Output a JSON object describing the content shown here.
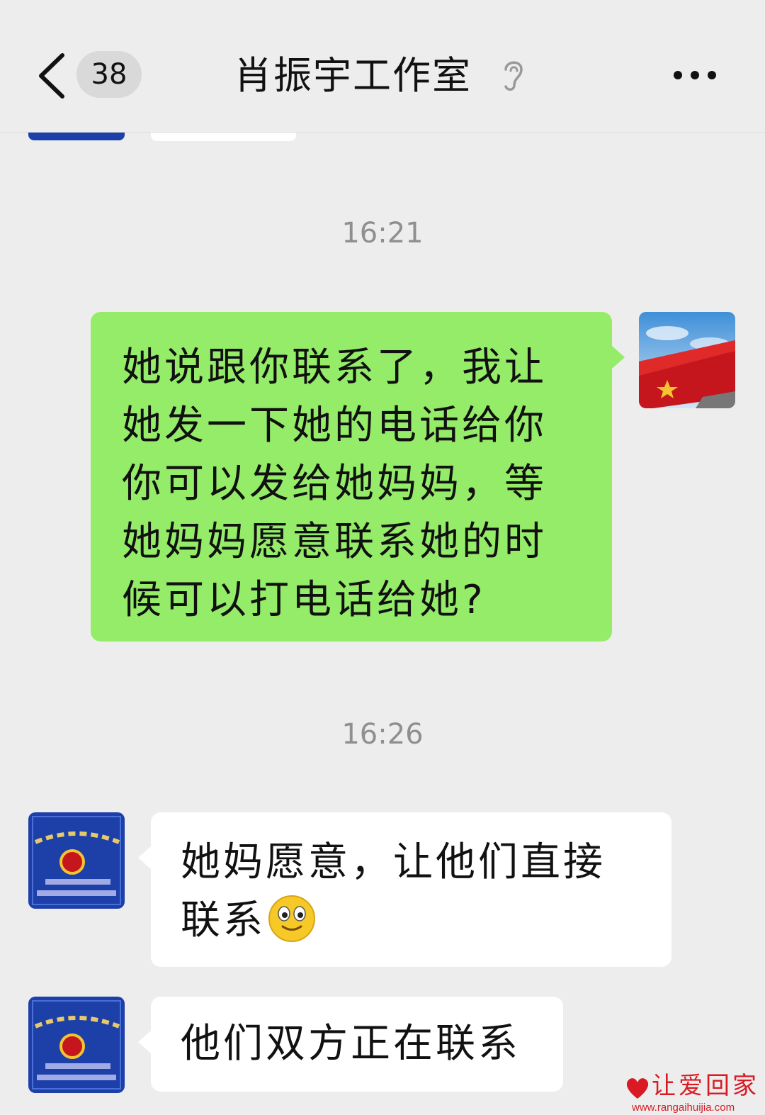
{
  "header": {
    "back_icon": "chevron-left-icon",
    "unread_count": "38",
    "title": "肖振宇工作室",
    "ear_icon": "ear-icon",
    "more_icon": "more-horizontal-icon"
  },
  "messages": [
    {
      "type": "time",
      "text": "16:21"
    },
    {
      "type": "outgoing",
      "avatar": "red-flag-avatar",
      "lines": [
        "她说跟你联系了，我让",
        "她发一下她的电话给你",
        "你可以发给她妈妈，等",
        "她妈妈愿意联系她的时",
        "候可以打电话给她?"
      ]
    },
    {
      "type": "time",
      "text": "16:26"
    },
    {
      "type": "incoming",
      "avatar": "police-badge-avatar",
      "lines": [
        "她妈愿意，让他们直接",
        "联系"
      ],
      "emoji": "smile-emoji"
    },
    {
      "type": "incoming",
      "avatar": "police-badge-avatar",
      "lines": [
        "他们双方正在联系"
      ]
    }
  ],
  "watermark": {
    "text": "让爱回家",
    "url": "www.rangaihuijia.com",
    "color": "#d91a24"
  },
  "colors": {
    "background": "#ededed",
    "outgoing_bubble": "#95ec69",
    "incoming_bubble": "#ffffff",
    "timestamp": "#8f8f8f"
  }
}
